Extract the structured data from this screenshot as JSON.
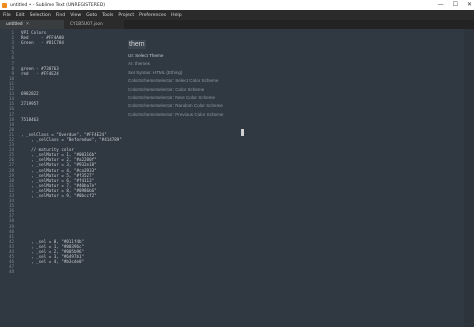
{
  "window": {
    "title": "untitled • - Sublime Text (UNREGISTERED)",
    "controls": [
      "—",
      "☐",
      "✕"
    ]
  },
  "menu": [
    "File",
    "Edit",
    "Selection",
    "Find",
    "View",
    "Goto",
    "Tools",
    "Project",
    "Preferences",
    "Help"
  ],
  "tabs": [
    {
      "label": "untitled",
      "close": "✕",
      "active": true
    },
    {
      "label": "CY1B5U07.json",
      "close": "",
      "active": false
    }
  ],
  "gutter_lines": [
    "1",
    "2",
    "3",
    "4",
    "5",
    "6",
    "7",
    "8",
    "9",
    "10",
    "11",
    "12",
    "13",
    "14",
    "15",
    "16",
    "17",
    "18",
    "19",
    "20",
    "21",
    "22",
    "23",
    "24",
    "25",
    "26",
    "27",
    "28",
    "29",
    "30",
    "31",
    "32",
    "33",
    "34",
    "35",
    "36",
    "37",
    "38",
    "39",
    "40",
    "41",
    "42",
    "43",
    "44",
    "45",
    "46",
    "47",
    "48"
  ],
  "code_lines": [
    "VPI Colors",
    "Red     - #FF4A00",
    "Green   - #81C784",
    "",
    "",
    "",
    "",
    "green - #738763",
    "red   - #FF4E24",
    "",
    "",
    "",
    "6982822",
    "",
    "2719957",
    "",
    "",
    "7518463",
    "",
    "",
    ", _selClass = \"Overdue\", \"#FF4E24\"",
    "    , _selClass = \"Beforedue\", \"#414789\"",
    "",
    "    // maturity color",
    "    , _selMatur = 1, \"#00316b\"",
    "    , _selMatur = 2, \"#a2200f\"",
    "    , _selMatur = 3, \"#932e18\"",
    "    , _selMatur = 4, \"#ca3933\"",
    "    , _selMatur = 5, \"#f3527\"",
    "    , _selMatur = 6, \"#f4113\"",
    "    , _selMatur = 7, \"#40ba7e\"",
    "    , _selMatur = 8, \"#0986b6\"",
    "    , _selMatur = 9, \"#0bccf2\"",
    "",
    "",
    "",
    "",
    "",
    "",
    "",
    "",
    "    , _sel = 0, \"#011f4b\"",
    "    , _sel = 1, \"#00396c\"",
    "    , _sel = 2, \"#005b96\"",
    "    , _sel = 3, \"#6497b1\"",
    "    , _sel = 4, \"#b3cde0\"",
    "",
    ""
  ],
  "command_palette": {
    "query": "them",
    "items": [
      "UI: Select Theme",
      "AI: themes",
      "Set Syntax: HTML (Ething)",
      "ColorSchemeSelector: Select Color Scheme",
      "ColorSchemeSelector: Color Scheme",
      "ColorSchemeSelector: Next Color Scheme",
      "ColorSchemeSelector: Random Color Scheme",
      "ColorSchemeSelector: Previous Color Scheme"
    ],
    "selected_index": 0
  },
  "colors": {
    "editor_bg": "#303841",
    "gutter_fg": "#7e8a95",
    "text_fg": "#c8ccd1",
    "app_icon": "#f28a1c"
  }
}
